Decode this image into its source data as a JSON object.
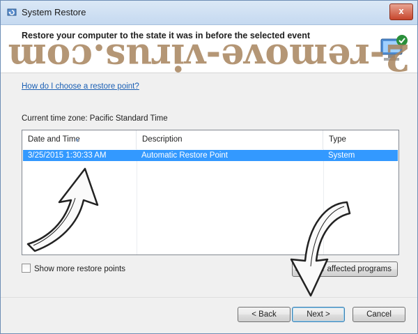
{
  "window": {
    "title": "System Restore",
    "close_symbol": "x"
  },
  "header": {
    "title": "Restore your computer to the state it was in before the selected event"
  },
  "help_link": "How do I choose a restore point?",
  "timezone": "Current time zone: Pacific Standard Time",
  "table": {
    "columns": [
      "Date and Time",
      "Description",
      "Type"
    ],
    "rows": [
      {
        "date": "3/25/2015 1:30:33 AM",
        "description": "Automatic Restore Point",
        "type": "System",
        "selected": true
      }
    ]
  },
  "show_more_label": "Show more restore points",
  "show_more_checked": false,
  "buttons": {
    "scan": "Scan for affected programs",
    "back": "< Back",
    "next": "Next >",
    "cancel": "Cancel"
  },
  "watermark_text": "2-remove-virus.com",
  "colors": {
    "selection": "#3399ff",
    "link": "#1a5fb4",
    "watermark": "#a8845e"
  }
}
